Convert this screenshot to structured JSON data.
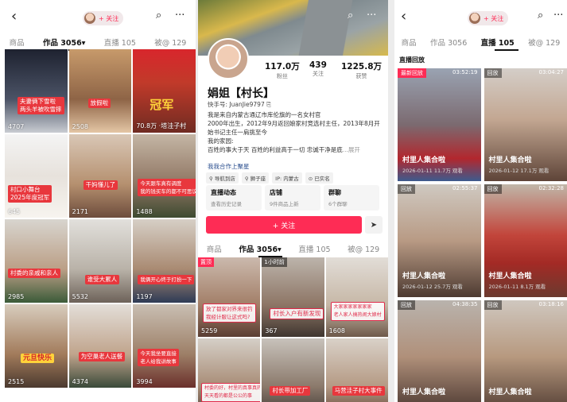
{
  "colors": {
    "accent": "#fe2c55",
    "link": "#2b4f8f"
  },
  "topbar": {
    "back_icon": "‹",
    "search_icon": "⌕",
    "more_icon": "···",
    "follow_label": "+ 关注"
  },
  "tabs": {
    "works": "作品 3056",
    "works_left": "作品 3056▾",
    "live": "直播 105",
    "collect": "被@ 129",
    "products": "商品"
  },
  "left_grid": [
    {
      "caption": "夫妻俩下雪啦\n两头羊被吹雪摔",
      "likes": "4707"
    },
    {
      "caption": "放假啦",
      "likes": "2508"
    },
    {
      "caption": "冠军",
      "likes": "70.8万 ·塔洼子村"
    },
    {
      "caption": "村口小舞台\n2025年度冠军",
      "likes": "645"
    },
    {
      "caption": "干妈懂儿了",
      "likes": "2171"
    },
    {
      "caption": "今天跟车真有调度\n我的钱买车的都不可思议",
      "likes": "1488"
    },
    {
      "caption": "村委的亲戚和亲人",
      "likes": "2985"
    },
    {
      "caption": "谁受大累人",
      "likes": "5532"
    },
    {
      "caption": "我俩开心终于打扮一下",
      "likes": "1197"
    },
    {
      "caption": "元旦快乐",
      "likes": "2515"
    },
    {
      "caption": "为空巢老人送餐",
      "likes": "4374"
    },
    {
      "caption": "今天我坐要直接\n老人给我讲故事",
      "likes": "3994"
    }
  ],
  "profile": {
    "stats": [
      {
        "n": "117.0万",
        "l": "粉丝"
      },
      {
        "n": "439",
        "l": "关注"
      },
      {
        "n": "1225.8万",
        "l": "获赞"
      }
    ],
    "name": "娟姐【村长】",
    "uid": "快手号: JuanJie9797 ⎘",
    "bio": "我是来自内蒙古通辽市库伦旗的一名女村官\n2000年出生，2012年9月返回娘家村竞选村主任，2013年8月开始书记主任一肩挑至今\n我的家园:\n百姓的事大于天 百姓的利益高于一切 忠诚干净是底",
    "bio_more": "...展开",
    "coop": "我我合作上聚星",
    "chips": [
      "⚲ 导航到店",
      "⚲ 狮子座",
      "IP: 内蒙古",
      "⊙ 已实名"
    ],
    "cards": [
      {
        "t": "直播动态",
        "s": "查看历史记录"
      },
      {
        "t": "店铺",
        "s": "9件商品上新"
      },
      {
        "t": "群聊",
        "s": "6个群聊"
      }
    ],
    "follow": "+ 关注",
    "share_icon": "➤"
  },
  "middle_grid": [
    {
      "tag": "置顶",
      "time": "1小时前",
      "caption": "放了都家对界来很钓\n我经计服让这式吗?",
      "likes": "5259"
    },
    {
      "tag": "",
      "time": "",
      "caption": "村长入户有新发现",
      "likes": "367"
    },
    {
      "tag": "",
      "time": "",
      "caption": "大家家家家家家家\n老人家人搞热闹大娘村",
      "likes": "1608"
    },
    {
      "tag": "",
      "time": "",
      "caption": "村委的好，村里的真事真的\n天天看的都是公公的事",
      "likes": ""
    },
    {
      "tag": "",
      "time": "",
      "caption": "村长带加工厂",
      "likes": ""
    },
    {
      "tag": "",
      "time": "",
      "caption": "马营洼子村大事件",
      "likes": ""
    }
  ],
  "live": {
    "section": "直播回放",
    "items": [
      {
        "tag": "最新回放",
        "dur": "03:52:19",
        "title": "村里人集合啦",
        "meta": "2026-01-11  11.7万 观看"
      },
      {
        "tag": "回放",
        "dur": "03:04:27",
        "title": "村里人集合啦",
        "meta": "2026-01-12  17.1万 观看"
      },
      {
        "tag": "回放",
        "dur": "02:55:37",
        "title": "村里人集合啦",
        "meta": "2026-01-12  25.7万 观看"
      },
      {
        "tag": "回放",
        "dur": "02:32:28",
        "title": "村里人集合啦",
        "meta": "2026-01-11  8.1万 观看"
      },
      {
        "tag": "回放",
        "dur": "04:38:35",
        "title": "村里人集合啦",
        "meta": ""
      },
      {
        "tag": "回放",
        "dur": "03:18:16",
        "title": "村里人集合啦",
        "meta": ""
      }
    ]
  }
}
